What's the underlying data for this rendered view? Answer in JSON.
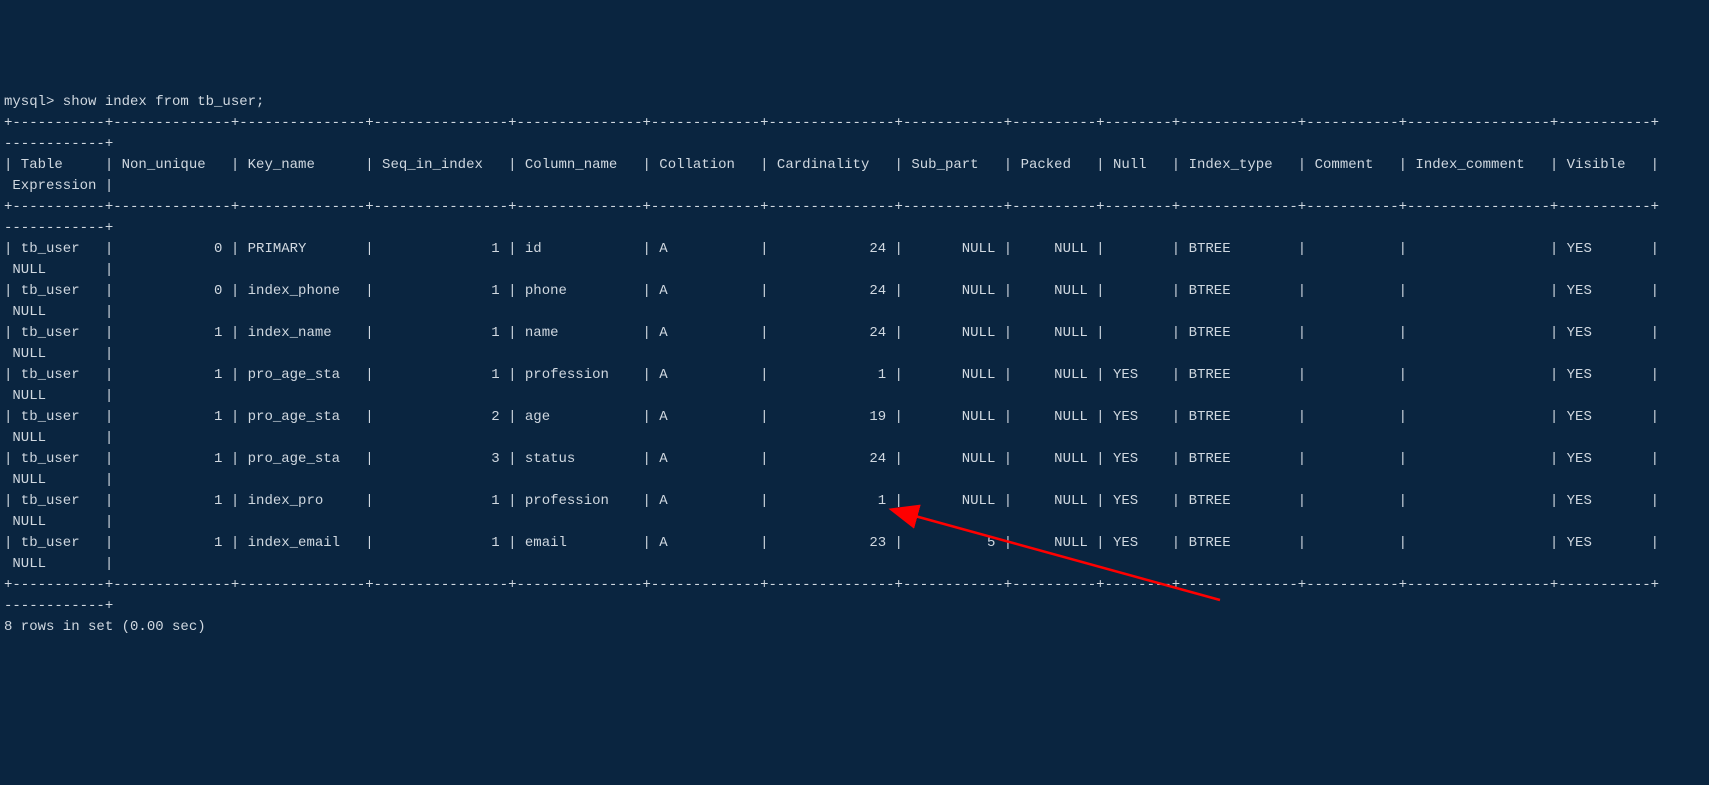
{
  "prompt": "mysql> ",
  "command": "show index from tb_user;",
  "columns": [
    "Table",
    "Non_unique",
    "Key_name",
    "Seq_in_index",
    "Column_name",
    "Collation",
    "Cardinality",
    "Sub_part",
    "Packed",
    "Null",
    "Index_type",
    "Comment",
    "Index_comment",
    "Visible",
    "Expression"
  ],
  "rows": [
    {
      "Table": "tb_user",
      "Non_unique": "0",
      "Key_name": "PRIMARY",
      "Seq_in_index": "1",
      "Column_name": "id",
      "Collation": "A",
      "Cardinality": "24",
      "Sub_part": "NULL",
      "Packed": "NULL",
      "Null": "",
      "Index_type": "BTREE",
      "Comment": "",
      "Index_comment": "",
      "Visible": "YES",
      "Expression": "NULL"
    },
    {
      "Table": "tb_user",
      "Non_unique": "0",
      "Key_name": "index_phone",
      "Seq_in_index": "1",
      "Column_name": "phone",
      "Collation": "A",
      "Cardinality": "24",
      "Sub_part": "NULL",
      "Packed": "NULL",
      "Null": "",
      "Index_type": "BTREE",
      "Comment": "",
      "Index_comment": "",
      "Visible": "YES",
      "Expression": "NULL"
    },
    {
      "Table": "tb_user",
      "Non_unique": "1",
      "Key_name": "index_name",
      "Seq_in_index": "1",
      "Column_name": "name",
      "Collation": "A",
      "Cardinality": "24",
      "Sub_part": "NULL",
      "Packed": "NULL",
      "Null": "",
      "Index_type": "BTREE",
      "Comment": "",
      "Index_comment": "",
      "Visible": "YES",
      "Expression": "NULL"
    },
    {
      "Table": "tb_user",
      "Non_unique": "1",
      "Key_name": "pro_age_sta",
      "Seq_in_index": "1",
      "Column_name": "profession",
      "Collation": "A",
      "Cardinality": "1",
      "Sub_part": "NULL",
      "Packed": "NULL",
      "Null": "YES",
      "Index_type": "BTREE",
      "Comment": "",
      "Index_comment": "",
      "Visible": "YES",
      "Expression": "NULL"
    },
    {
      "Table": "tb_user",
      "Non_unique": "1",
      "Key_name": "pro_age_sta",
      "Seq_in_index": "2",
      "Column_name": "age",
      "Collation": "A",
      "Cardinality": "19",
      "Sub_part": "NULL",
      "Packed": "NULL",
      "Null": "YES",
      "Index_type": "BTREE",
      "Comment": "",
      "Index_comment": "",
      "Visible": "YES",
      "Expression": "NULL"
    },
    {
      "Table": "tb_user",
      "Non_unique": "1",
      "Key_name": "pro_age_sta",
      "Seq_in_index": "3",
      "Column_name": "status",
      "Collation": "A",
      "Cardinality": "24",
      "Sub_part": "NULL",
      "Packed": "NULL",
      "Null": "YES",
      "Index_type": "BTREE",
      "Comment": "",
      "Index_comment": "",
      "Visible": "YES",
      "Expression": "NULL"
    },
    {
      "Table": "tb_user",
      "Non_unique": "1",
      "Key_name": "index_pro",
      "Seq_in_index": "1",
      "Column_name": "profession",
      "Collation": "A",
      "Cardinality": "1",
      "Sub_part": "NULL",
      "Packed": "NULL",
      "Null": "YES",
      "Index_type": "BTREE",
      "Comment": "",
      "Index_comment": "",
      "Visible": "YES",
      "Expression": "NULL"
    },
    {
      "Table": "tb_user",
      "Non_unique": "1",
      "Key_name": "index_email",
      "Seq_in_index": "1",
      "Column_name": "email",
      "Collation": "A",
      "Cardinality": "23",
      "Sub_part": "5",
      "Packed": "NULL",
      "Null": "YES",
      "Index_type": "BTREE",
      "Comment": "",
      "Index_comment": "",
      "Visible": "YES",
      "Expression": "NULL"
    }
  ],
  "footer": "8 rows in set (0.00 sec)",
  "widths": {
    "Table": 9,
    "Non_unique": 12,
    "Key_name": 13,
    "Seq_in_index": 14,
    "Column_name": 13,
    "Collation": 11,
    "Cardinality": 13,
    "Sub_part": 10,
    "Packed": 8,
    "Null": 6,
    "Index_type": 12,
    "Comment": 9,
    "Index_comment": 15,
    "Visible": 9,
    "Expression": 10
  },
  "align": {
    "Table": "left",
    "Non_unique": "right",
    "Key_name": "left",
    "Seq_in_index": "right",
    "Column_name": "left",
    "Collation": "left",
    "Cardinality": "right",
    "Sub_part": "right",
    "Packed": "right",
    "Null": "left",
    "Index_type": "left",
    "Comment": "left",
    "Index_comment": "left",
    "Visible": "left",
    "Expression": "left"
  }
}
